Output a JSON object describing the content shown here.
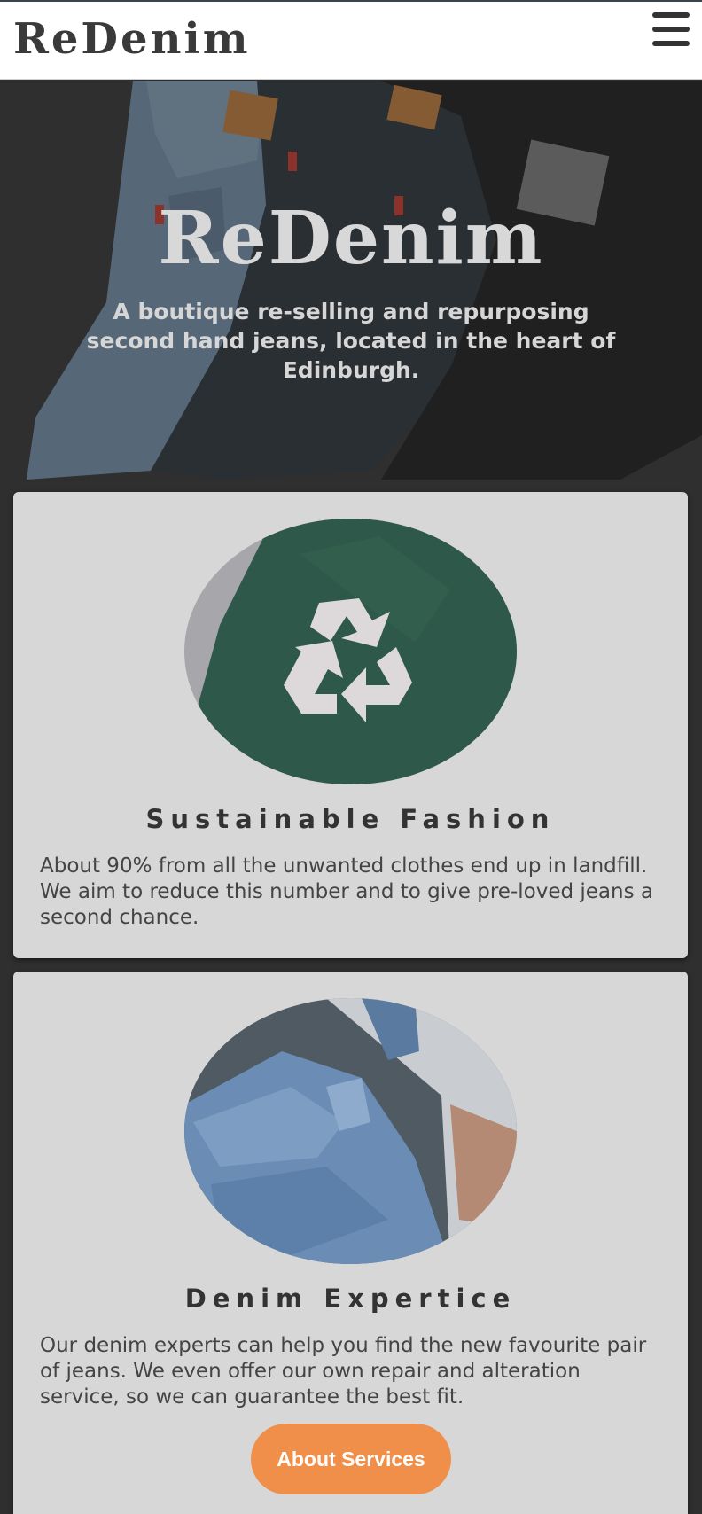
{
  "header": {
    "logo": "ReDenim",
    "menu_icon": "hamburger-menu-icon"
  },
  "hero": {
    "title": "ReDenim",
    "tagline": "A boutique re-selling and repurposing second hand jeans, located in the heart of Edinburgh."
  },
  "cards": [
    {
      "title": "Sustainable Fashion",
      "text": "About 90% from all the unwanted clothes end up in landfill. We aim to reduce this number and to give pre-loved jeans a second chance.",
      "image_icon": "recycle-icon"
    },
    {
      "title": "Denim Expertice",
      "text": "Our denim experts can help you find the new favourite pair of jeans. We even offer our own repair and alteration service, so we can guarantee the best fit.",
      "button_label": "About Services"
    }
  ],
  "colors": {
    "accent": "#ef8f4a",
    "card_bg": "#d7d7d7",
    "page_bg": "#2f2f2f",
    "nav_bg": "#ffffff"
  }
}
